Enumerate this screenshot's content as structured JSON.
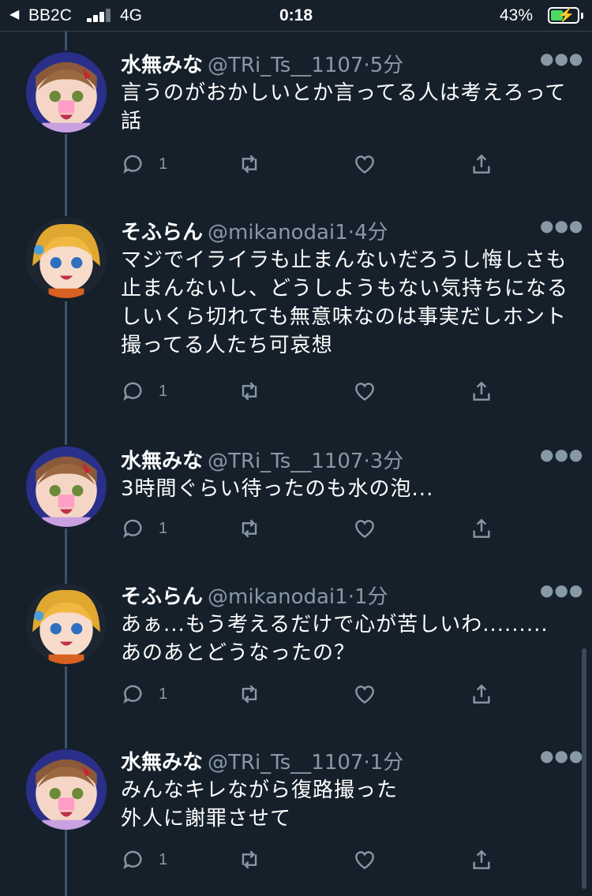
{
  "status_bar": {
    "back_glyph": "◀",
    "carrier": "BB2C",
    "network": "4G",
    "time": "0:18",
    "battery_percent": "43%",
    "battery_level": 0.43,
    "charging": true
  },
  "colors": {
    "background": "#15202b",
    "secondary_text": "#8899a6",
    "thread_line": "#3d5466"
  },
  "tweets": [
    {
      "name": "水無みな",
      "handle": "@TRi_Ts__1107",
      "time": "·5分",
      "text": "言うのがおかしいとか言ってる人は考えろって話",
      "reply_count": "1",
      "avatar": "mina"
    },
    {
      "name": "そふらん",
      "handle": "@mikanodai1",
      "time": "·4分",
      "text": "マジでイライラも止まんないだろうし悔しさも止まんないし、どうしようもない気持ちになるしいくら切れても無意味なのは事実だしホント撮ってる人たち可哀想",
      "reply_count": "1",
      "avatar": "sofuran"
    },
    {
      "name": "水無みな",
      "handle": "@TRi_Ts__1107",
      "time": "·3分",
      "text": "3時間ぐらい待ったのも水の泡...",
      "reply_count": "1",
      "avatar": "mina"
    },
    {
      "name": "そふらん",
      "handle": "@mikanodai1",
      "time": "·1分",
      "text": "あぁ...もう考えるだけで心が苦しいわ.........\nあのあとどうなったの？",
      "reply_count": "1",
      "avatar": "sofuran"
    },
    {
      "name": "水無みな",
      "handle": "@TRi_Ts__1107",
      "time": "·1分",
      "text": "みんなキレながら復路撮った\n外人に謝罪させて",
      "reply_count": "1",
      "avatar": "mina"
    }
  ],
  "icons": {
    "more": "more-icon",
    "reply": "reply-icon",
    "retweet": "retweet-icon",
    "like": "heart-icon",
    "share": "share-icon"
  }
}
